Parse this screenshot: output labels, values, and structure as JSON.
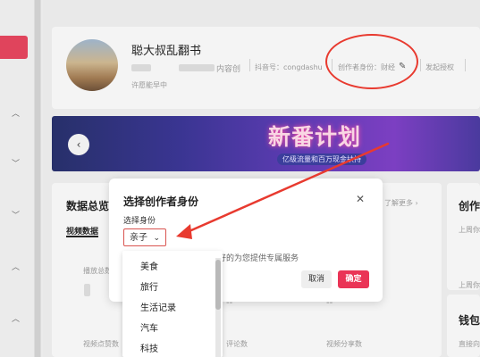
{
  "profile": {
    "name": "聪大叔乱翻书",
    "douyin_id": "抖音号：congdashu",
    "creator_identity": "创作者身份：财经",
    "authorize_text": "发起授权",
    "blurred_suffix": "内容创",
    "signature": "许愿能早中"
  },
  "banner": {
    "title": "新番计划",
    "subtitle": "亿级流量和百万现金扶持",
    "left_arrow": "‹"
  },
  "background": {
    "data_title": "数据总览",
    "video_tab": "视频数据",
    "learn_more": "了解更多 ›",
    "right_title": "创作",
    "week_text1": "上周你",
    "week_text2": "上周你",
    "wallet_title": "钱包",
    "wallet_sub": "直接向",
    "stat1": "播放总数",
    "stat2": "主页访问",
    "stat3": "评论数",
    "stat4": "视频分享数",
    "stat5": "视频点赞数",
    "dash1": "--",
    "dash2": "--",
    "help_text": "好的为您提供专属服务"
  },
  "modal": {
    "title": "选择创作者身份",
    "close": "✕",
    "label": "选择身份",
    "selected": "亲子",
    "cancel": "取消",
    "confirm": "确定"
  },
  "dropdown": {
    "options": [
      "美食",
      "旅行",
      "生活记录",
      "汽车",
      "科技"
    ]
  },
  "colors": {
    "accent": "#ea3456",
    "annotation": "#e83a2f"
  }
}
